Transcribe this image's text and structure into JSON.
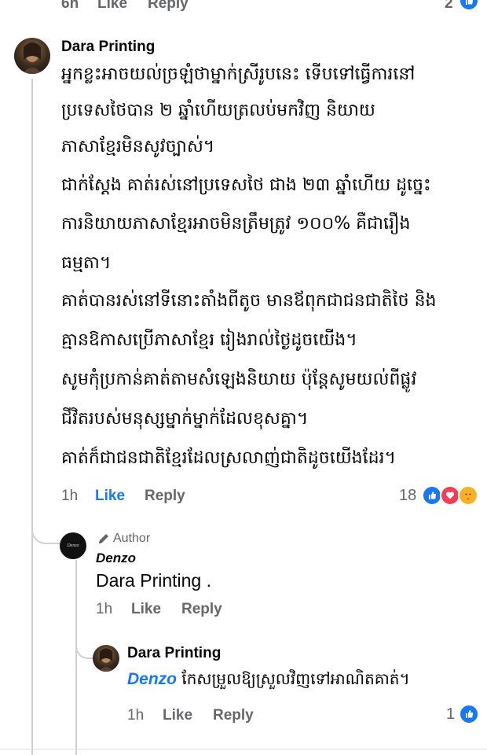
{
  "top_bar": {
    "time": "6h",
    "like": "Like",
    "reply": "Reply",
    "reaction_count": "2"
  },
  "comment": {
    "author": "Dara Printing",
    "lines": [
      "អ្នកខ្លះអាចយល់ច្រឡំថាម្នាក់ស្រីរូបនេះ ទើបទៅធ្វើការនៅ",
      "ប្រទេសថៃបាន ២ ឆ្នាំហើយត្រលប់មកវិញ និយាយ",
      "ភាសាខ្មែរមិនសូវច្បាស់។",
      "ជាក់ស្តែង គាត់រស់នៅប្រទេសថៃ ជាង ២៣ ឆ្នាំហើយ ដូច្នេះ",
      "ការនិយាយភាសាខ្មែរអាចមិនត្រឹមត្រូវ ១០០% គឺជារឿង",
      "ធម្មតា។",
      "គាត់បានរស់នៅទីនោះតាំងពីតូច មានឪពុកជាជនជាតិថៃ និង",
      "គ្មានឱកាសប្រើភាសាខ្មែរ រៀងរាល់ថ្ងៃដូចយើង។",
      "សូមកុំប្រកាន់គាត់តាមសំឡេងនិយាយ ប៉ុន្តែសូមយល់ពីផ្លូវ",
      "ជីវិតរបស់មនុស្សម្នាក់ម្នាក់ដែលខុសគ្នា។",
      "គាត់ក៏ជាជនជាតិខ្មែរដែលស្រលាញ់ជាតិដូចយើងដែរ។"
    ],
    "time": "1h",
    "like": "Like",
    "reply": "Reply",
    "reaction_count": "18"
  },
  "reply1": {
    "badge": "Author",
    "author": "Denzo",
    "avatar_text": "Denzo",
    "text": "Dara Printing .",
    "time": "1h",
    "like": "Like",
    "reply": "Reply"
  },
  "reply2": {
    "author": "Dara Printing",
    "mention": "Denzo",
    "text": " កែសម្រួលឱ្យស្រួលវិញទៅអាណិតគាត់។",
    "time": "1h",
    "like": "Like",
    "reply": "Reply",
    "reaction_count": "1"
  }
}
